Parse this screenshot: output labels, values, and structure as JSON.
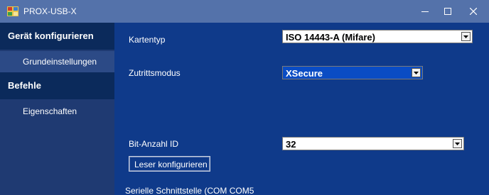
{
  "window": {
    "title": "PROX-USB-X"
  },
  "sidebar": {
    "header_configure": "Gerät konfigurieren",
    "item_basic_settings": "Grundeinstellungen",
    "header_commands": "Befehle",
    "item_properties": "Eigenschaften"
  },
  "form": {
    "card_type_label": "Kartentyp",
    "card_type_value": "ISO 14443-A (Mifare)",
    "access_mode_label": "Zutrittsmodus",
    "access_mode_value": "XSecure",
    "bit_count_label": "Bit-Anzahl ID",
    "bit_count_value": "32",
    "configure_button": "Leser konfigurieren"
  },
  "status": {
    "text": "Serielle Schnittstelle (COM COM5"
  },
  "colors": {
    "titlebar": "#5472aa",
    "sidebar": "#1f3a72",
    "sidebar_header": "#0b2a5b",
    "main": "#0f3a8a",
    "selected_dropdown": "#0a4cc4"
  }
}
